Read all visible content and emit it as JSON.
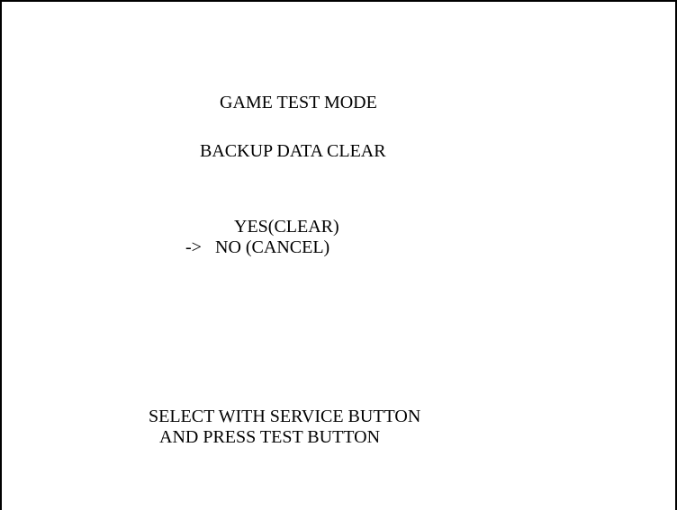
{
  "screen": {
    "title": "GAME TEST MODE",
    "subtitle": "BACKUP DATA CLEAR",
    "options": [
      {
        "label": "YES(CLEAR)",
        "selected": false
      },
      {
        "label": "NO (CANCEL)",
        "selected": true
      }
    ],
    "cursor": "->",
    "instructions": [
      "SELECT WITH SERVICE BUTTON",
      "AND PRESS TEST BUTTON"
    ],
    "colors": {
      "background": "#ffffff",
      "text": "#000000",
      "border": "#000000"
    }
  }
}
